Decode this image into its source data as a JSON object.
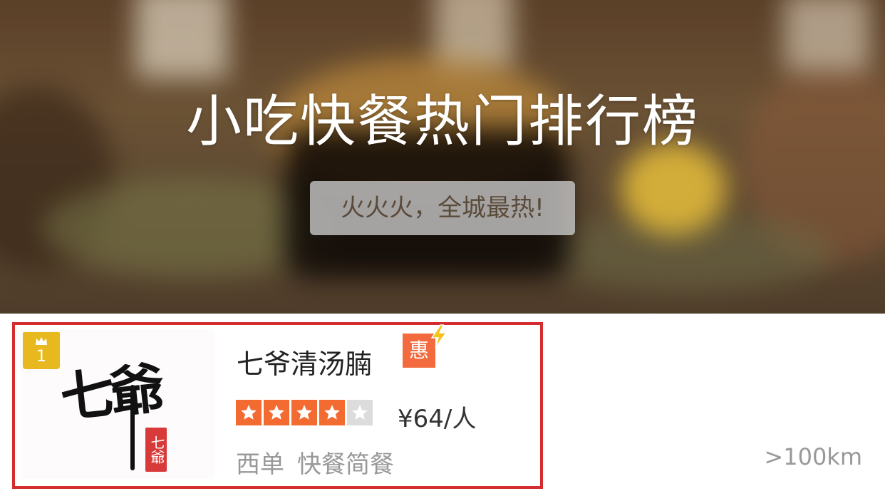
{
  "banner": {
    "title": "小吃快餐热门排行榜",
    "tagline": "火火火，全城最热!"
  },
  "shop": {
    "rank": "1",
    "name": "七爷清汤腩",
    "promo_badge": "惠",
    "rating_stars": 4,
    "rating_max": 5,
    "price": "¥64/人",
    "area": "西单",
    "category": "快餐简餐",
    "distance": ">100km",
    "logo_text": "七爺",
    "logo_seal": "七爺",
    "icons": {
      "rank": "crown-icon",
      "promo": "bolt-icon",
      "rating": "star-icon"
    }
  },
  "colors": {
    "accent_star": "#f46b32",
    "rank_badge": "#e8b91e",
    "highlight_border": "#d32d2f"
  }
}
